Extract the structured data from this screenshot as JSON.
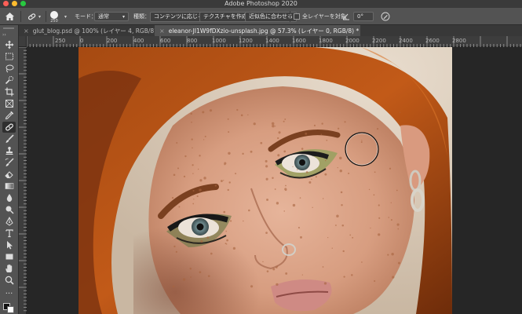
{
  "app": {
    "title": "Adobe Photoshop 2020"
  },
  "options_bar": {
    "brush_size": "250",
    "mode_label": "モード：",
    "mode_value": "通常",
    "type_label": "種類：",
    "content_aware": "コンテンツに応じる",
    "create_texture": "テクスチャを作成",
    "proximity_match": "近似色に合わせる",
    "sample_all_layers": "全レイヤーを対象",
    "angle_value": "0°"
  },
  "tabs": [
    {
      "label": "glut_blog.psd @ 100% (レイヤー 4, RGB/8) *",
      "active": false
    },
    {
      "label": "eleanor-JI1W9fDXzio-unsplash.jpg @ 57.3% (レイヤー 0, RGB/8) *",
      "active": true
    }
  ],
  "ruler": {
    "ticks": [
      "250",
      "0",
      "200",
      "400",
      "600",
      "800",
      "1000",
      "1200",
      "1400",
      "1600",
      "1800",
      "2000",
      "2200",
      "2400",
      "2600",
      "2800"
    ]
  },
  "tools": [
    "move-tool-icon",
    "marquee-icon",
    "lasso-icon",
    "quick-select-icon",
    "crop-icon",
    "frame-icon",
    "eyedropper-icon",
    "spot-healing-brush-icon",
    "brush-icon",
    "clone-stamp-icon",
    "history-brush-icon",
    "eraser-icon",
    "gradient-icon",
    "blur-icon",
    "dodge-icon",
    "pen-icon",
    "type-icon",
    "path-select-icon",
    "rectangle-icon",
    "hand-icon",
    "zoom-icon"
  ],
  "colors": {
    "panel": "#535353",
    "dark_panel": "#383838",
    "canvas_bg": "#262626",
    "accent_red": "#ff5f57"
  }
}
